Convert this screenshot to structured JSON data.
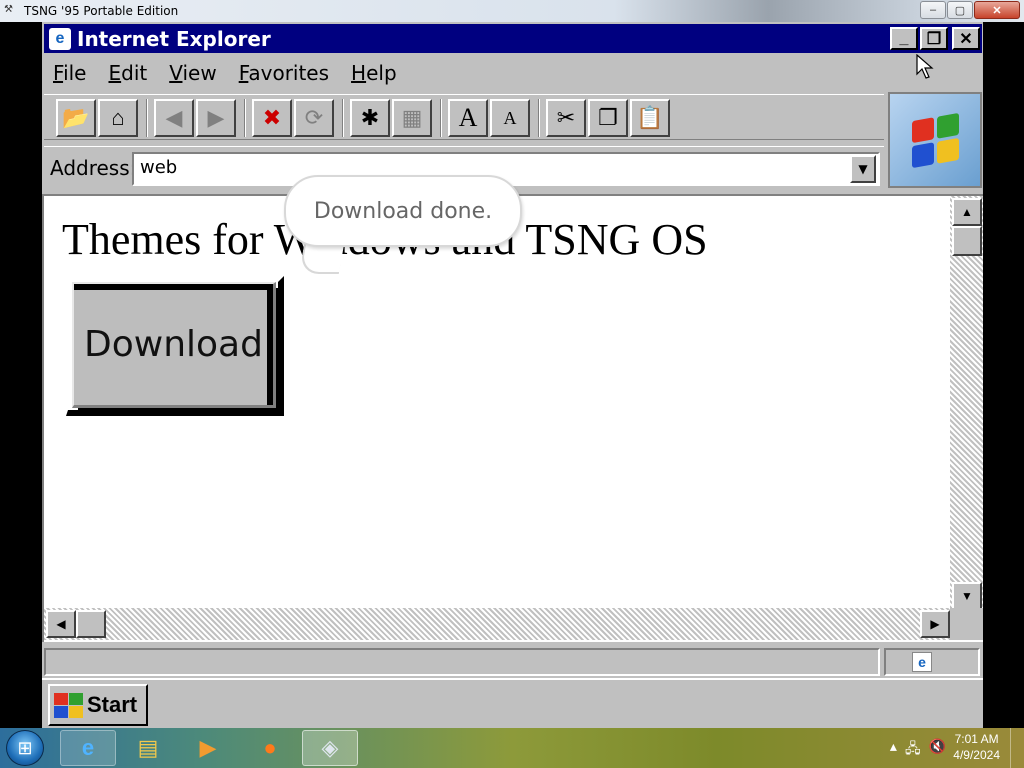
{
  "host": {
    "title": "TSNG '95 Portable Edition",
    "controls": {
      "min": "–",
      "max": "▢",
      "close": "✕"
    }
  },
  "ie": {
    "title": "Internet Explorer",
    "controls": {
      "min": "_",
      "max": "❐",
      "close": "✕"
    },
    "menu": [
      {
        "key": "F",
        "rest": "ile"
      },
      {
        "key": "E",
        "rest": "dit"
      },
      {
        "key": "V",
        "rest": "iew"
      },
      {
        "key": "F",
        "rest": "avorites"
      },
      {
        "key": "H",
        "rest": "elp"
      }
    ],
    "address": {
      "label": "Address:",
      "value": "web"
    },
    "page": {
      "heading": "Themes for Windows and TSNG OS",
      "download_button": "Download"
    },
    "tooltip": "Download done."
  },
  "emu_taskbar": {
    "start_label": "Start"
  },
  "host_taskbar": {
    "time": "7:01 AM",
    "date": "4/9/2024"
  },
  "colors": {
    "title_bar": "#000080",
    "window_face": "#c0c0c0"
  }
}
